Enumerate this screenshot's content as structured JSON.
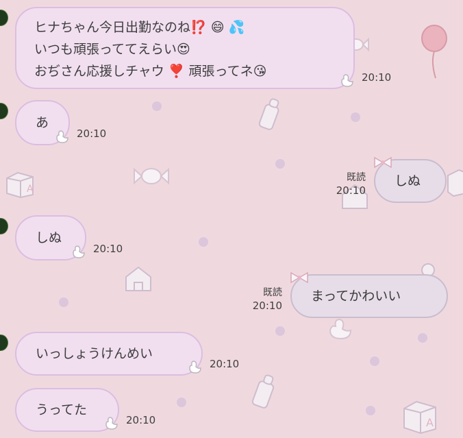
{
  "chat": {
    "messages": [
      {
        "lines": [
          "ヒナちゃん今日出勤なのね⁉️ 😄 💦",
          "いつも頑張っててえらい😍",
          "おぢさん応援しチャウ ❣️ 頑張ってネ😘"
        ],
        "time": "20:10"
      },
      {
        "text": "あ",
        "time": "20:10"
      },
      {
        "text": "しぬ",
        "read": "既読",
        "time": "20:10"
      },
      {
        "text": "しぬ",
        "time": "20:10"
      },
      {
        "text": "まってかわいい",
        "read": "既読",
        "time": "20:10"
      },
      {
        "text": "いっしょうけんめい",
        "time": "20:10"
      },
      {
        "text": "うってた",
        "time": "20:10"
      }
    ]
  },
  "colors": {
    "background": "#efd9df",
    "incoming_bubble": "#f1dff0",
    "outgoing_bubble": "#e7dde9"
  }
}
